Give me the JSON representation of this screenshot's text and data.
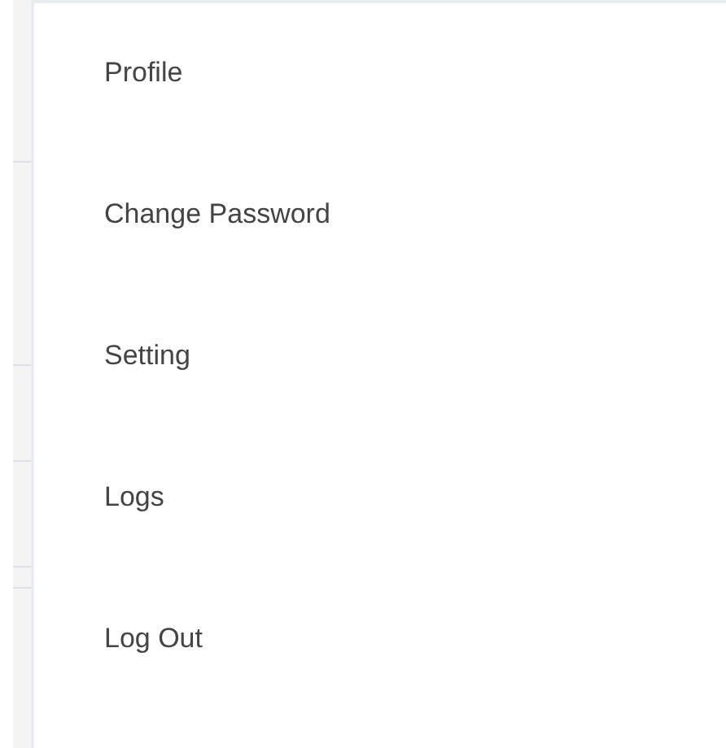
{
  "menu": {
    "items": [
      {
        "label": "Profile"
      },
      {
        "label": "Change Password"
      },
      {
        "label": "Setting"
      },
      {
        "label": "Logs"
      },
      {
        "label": "Log Out"
      }
    ]
  }
}
